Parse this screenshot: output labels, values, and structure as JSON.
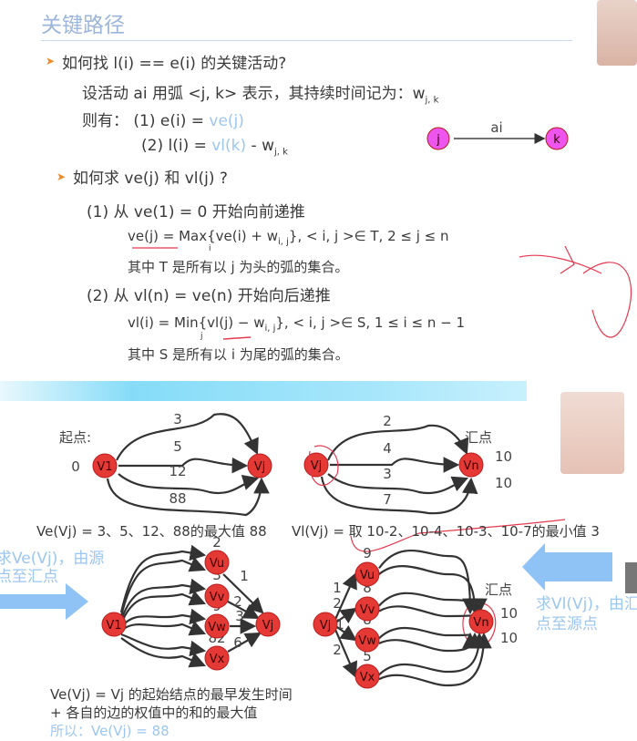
{
  "title": "关键路径",
  "q1": "如何找 l(i) == e(i) 的关键活动?",
  "def": {
    "text": "设活动 ai 用弧 <j, k> 表示，其持续时间记为：w",
    "sub": "j, k"
  },
  "then": {
    "label": "则有：",
    "l1a": "(1)   e(i) = ",
    "l1b": "ve(j)",
    "l2a": "(2)   l(i) = ",
    "l2b": "vl(k)",
    "l2c": " - w",
    "l2sub": "j, k"
  },
  "arc": {
    "from": "j",
    "to": "k",
    "label": "ai"
  },
  "q2": "如何求 ve(j) 和 vl(j) ?",
  "step1": {
    "head": "(1)   从 ve(1) = 0 开始向前递推",
    "formula_a": "ve(j)  =  Max{ve(i) + w",
    "formula_sub": "i, j",
    "formula_b": "},  < i, j >∈  T,  2  ≤  j  ≤  n",
    "under": "i",
    "note": "其中 T 是所有以  j 为头的弧的集合。"
  },
  "step2": {
    "head": "(2)   从 vl(n) = ve(n) 开始向后递推",
    "formula_a": "vl(i)  =  Min{vl(j)  −  w",
    "formula_sub": "i, j",
    "formula_b": "},    < i, j >∈  S,  1 ≤ i ≤ n − 1",
    "under": "j",
    "note": "其中 S 是所有以  i 为尾的弧的集合。"
  },
  "graph1": {
    "start_label": "起点:",
    "start_value": "0",
    "nodes": [
      "V1",
      "Vj"
    ],
    "edges": [
      "3",
      "5",
      "12",
      "88"
    ],
    "caption": "Ve(Vj) = 3、5、12、88的最大值 88"
  },
  "graph2": {
    "sink_label": "汇点",
    "nodes": [
      "Vj",
      "Vn"
    ],
    "edges": [
      "2",
      "4",
      "3",
      "7"
    ],
    "values": [
      "10",
      "10"
    ],
    "caption": "Vl(Vj) = 取 10-2、10-4、10-3、10-7的最小值 3"
  },
  "graph3": {
    "nodes": [
      "V1",
      "Vu",
      "Vv",
      "Vw",
      "Vx",
      "Vj"
    ],
    "in_labels": [
      "2",
      "3",
      "9",
      "82"
    ],
    "out_labels": [
      "1",
      "2",
      "3",
      "6"
    ]
  },
  "graph4": {
    "sink_label": "汇点",
    "nodes": [
      "Vj",
      "Vu",
      "Vv",
      "Vw",
      "Vx",
      "Vn"
    ],
    "in_labels": [
      "1",
      "2",
      "1",
      "2"
    ],
    "node_labels": [
      "9",
      "8",
      "8",
      "5"
    ],
    "values": [
      "10",
      "10"
    ]
  },
  "left_arrow_text": [
    "求Ve(Vj)，由源",
    "点至汇点"
  ],
  "right_arrow_text": [
    "求Vl(Vj)，由汇",
    "点至源点"
  ],
  "bottom": [
    "Ve(Vj) = Vj 的起始结点的最早发生时间",
    "+ 各自的边的权值中的和的最大值",
    "所以：Ve(Vj) = 88"
  ],
  "colors": {
    "node": "#e53935",
    "accent": "#9cc6f0",
    "title": "#9cb6da",
    "arc_node": "#ee55ee"
  }
}
